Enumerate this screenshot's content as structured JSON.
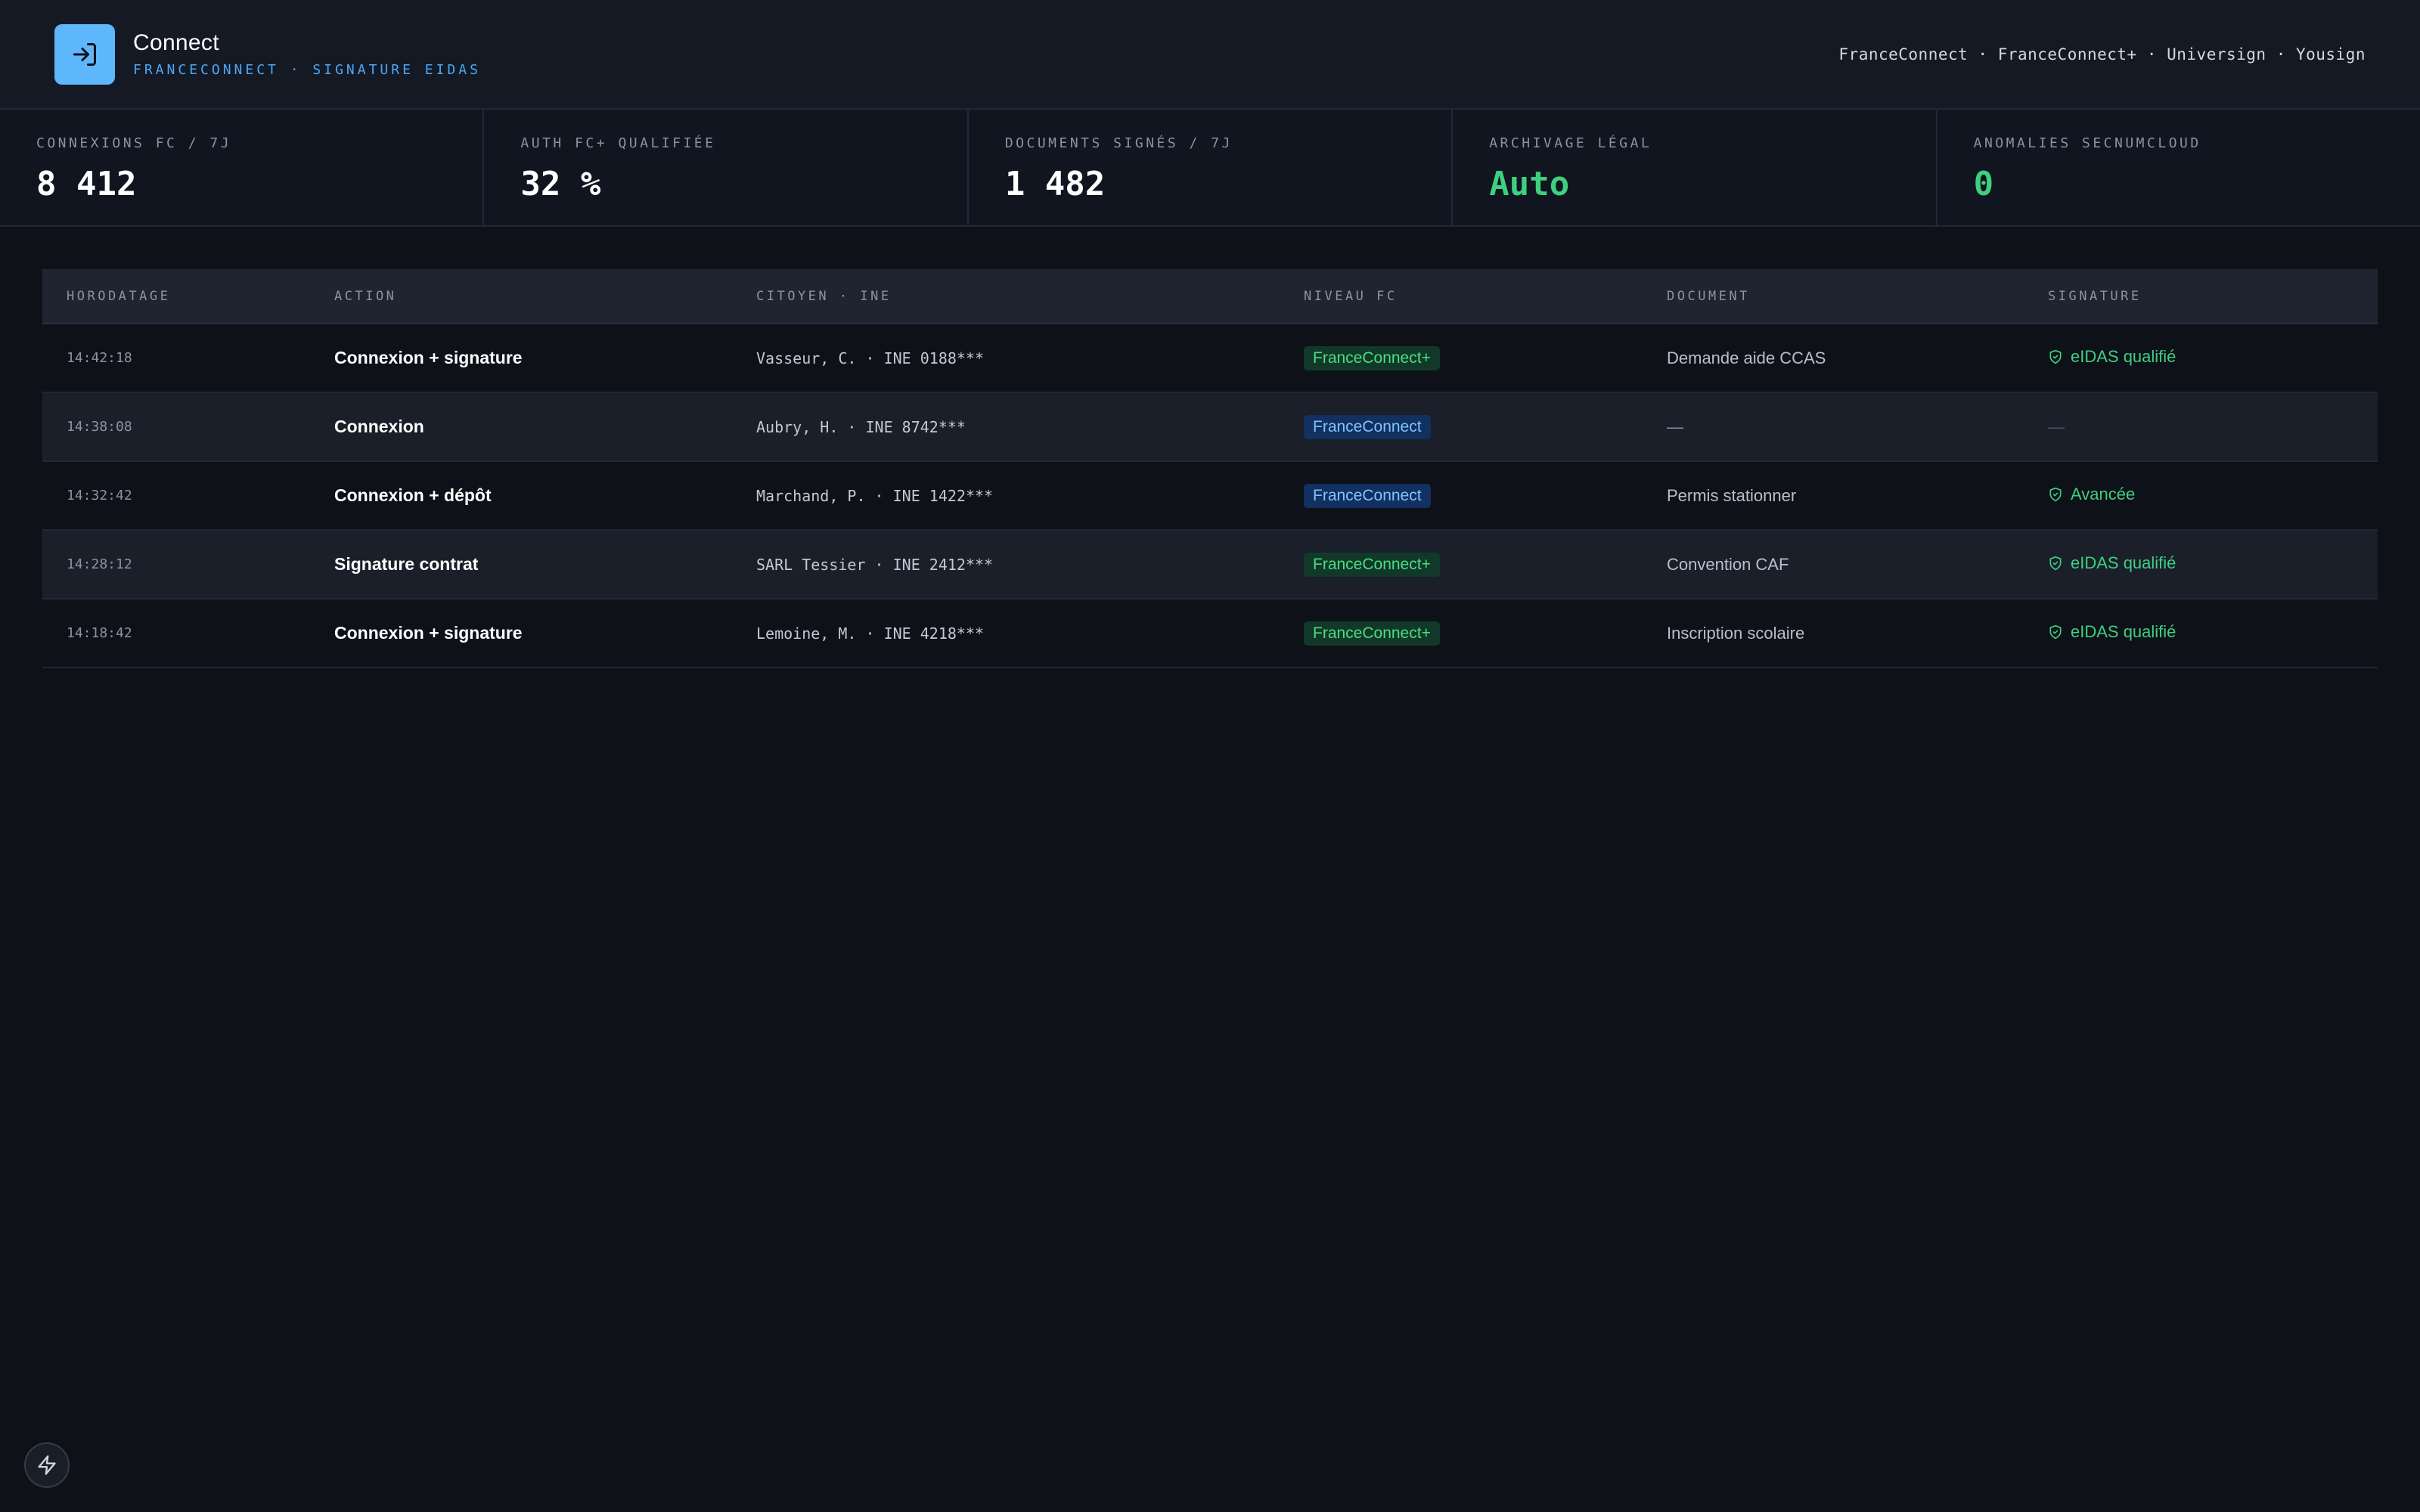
{
  "header": {
    "title": "Connect",
    "subtitle": "FRANCECONNECT · SIGNATURE EIDAS",
    "providers": "FranceConnect · FranceConnect+ · Universign · Yousign",
    "logo_icon": "login-arrow-icon"
  },
  "kpis": [
    {
      "label": "CONNEXIONS FC / 7J",
      "value": "8 412"
    },
    {
      "label": "AUTH FC+ QUALIFIÉE",
      "value": "32 %"
    },
    {
      "label": "DOCUMENTS SIGNÉS / 7J",
      "value": "1 482"
    },
    {
      "label": "ARCHIVAGE LÉGAL",
      "value": "Auto"
    },
    {
      "label": "ANOMALIES SECNUMCLOUD",
      "value": "0"
    }
  ],
  "table": {
    "headers": [
      "HORODATAGE",
      "ACTION",
      "CITOYEN · INE",
      "NIVEAU FC",
      "DOCUMENT",
      "SIGNATURE"
    ],
    "rows": [
      {
        "time": "14:42:18",
        "action": "Connexion + signature",
        "citizen": "Vasseur, C. · INE 0188***",
        "level": "FranceConnect+",
        "document": "Demande aide CCAS",
        "signature": "eIDAS qualifié"
      },
      {
        "time": "14:38:08",
        "action": "Connexion",
        "citizen": "Aubry, H. · INE 8742***",
        "level": "FranceConnect",
        "document": "—",
        "signature": "—"
      },
      {
        "time": "14:32:42",
        "action": "Connexion + dépôt",
        "citizen": "Marchand, P. · INE 1422***",
        "level": "FranceConnect",
        "document": "Permis stationner",
        "signature": "Avancée"
      },
      {
        "time": "14:28:12",
        "action": "Signature contrat",
        "citizen": "SARL Tessier · INE 2412***",
        "level": "FranceConnect+",
        "document": "Convention CAF",
        "signature": "eIDAS qualifié"
      },
      {
        "time": "14:18:42",
        "action": "Connexion + signature",
        "citizen": "Lemoine, M. · INE 4218***",
        "level": "FranceConnect+",
        "document": "Inscription scolaire",
        "signature": "eIDAS qualifié"
      }
    ]
  },
  "colors": {
    "accent": "#5eb6fb",
    "success": "#3ecf7f",
    "background": "#0e1118"
  },
  "floating_button_icon": "bolt-icon"
}
